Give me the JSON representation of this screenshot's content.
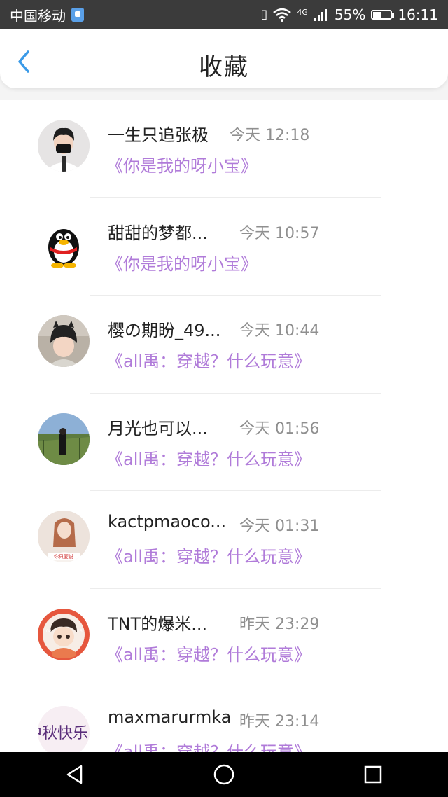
{
  "status_bar": {
    "carrier": "中国移动",
    "network": "4G",
    "battery": "55%",
    "battery_level": 0.55,
    "time": "16:11"
  },
  "header": {
    "title": "收藏",
    "back_icon": "chevron-left-icon",
    "accent_color": "#3a9ae8"
  },
  "favorites": [
    {
      "name": "一生只追张极",
      "time": "今天 12:18",
      "book": "《你是我的呀小宝》"
    },
    {
      "name": "甜甜的梦都...",
      "time": "今天 10:57",
      "book": "《你是我的呀小宝》"
    },
    {
      "name": "樱の期盼_49...",
      "time": "今天 10:44",
      "book": "《all禹：穿越？什么玩意》"
    },
    {
      "name": "月光也可以...",
      "time": "今天 01:56",
      "book": "《all禹：穿越？什么玩意》"
    },
    {
      "name": "kactpmaoco...",
      "time": "今天 01:31",
      "book": "《all禹：穿越？什么玩意》"
    },
    {
      "name": "TNT的爆米...",
      "time": "昨天 23:29",
      "book": "《all禹：穿越？什么玩意》"
    },
    {
      "name": "maxmarurmka",
      "time": "昨天 23:14",
      "book": "《all禹：穿越？什么玩意》"
    }
  ],
  "avatar_7_text": "中秋快乐",
  "book_color": "#b07bd9",
  "nav_bar": {
    "icons": [
      "back-triangle-icon",
      "home-circle-icon",
      "recents-square-icon"
    ]
  }
}
